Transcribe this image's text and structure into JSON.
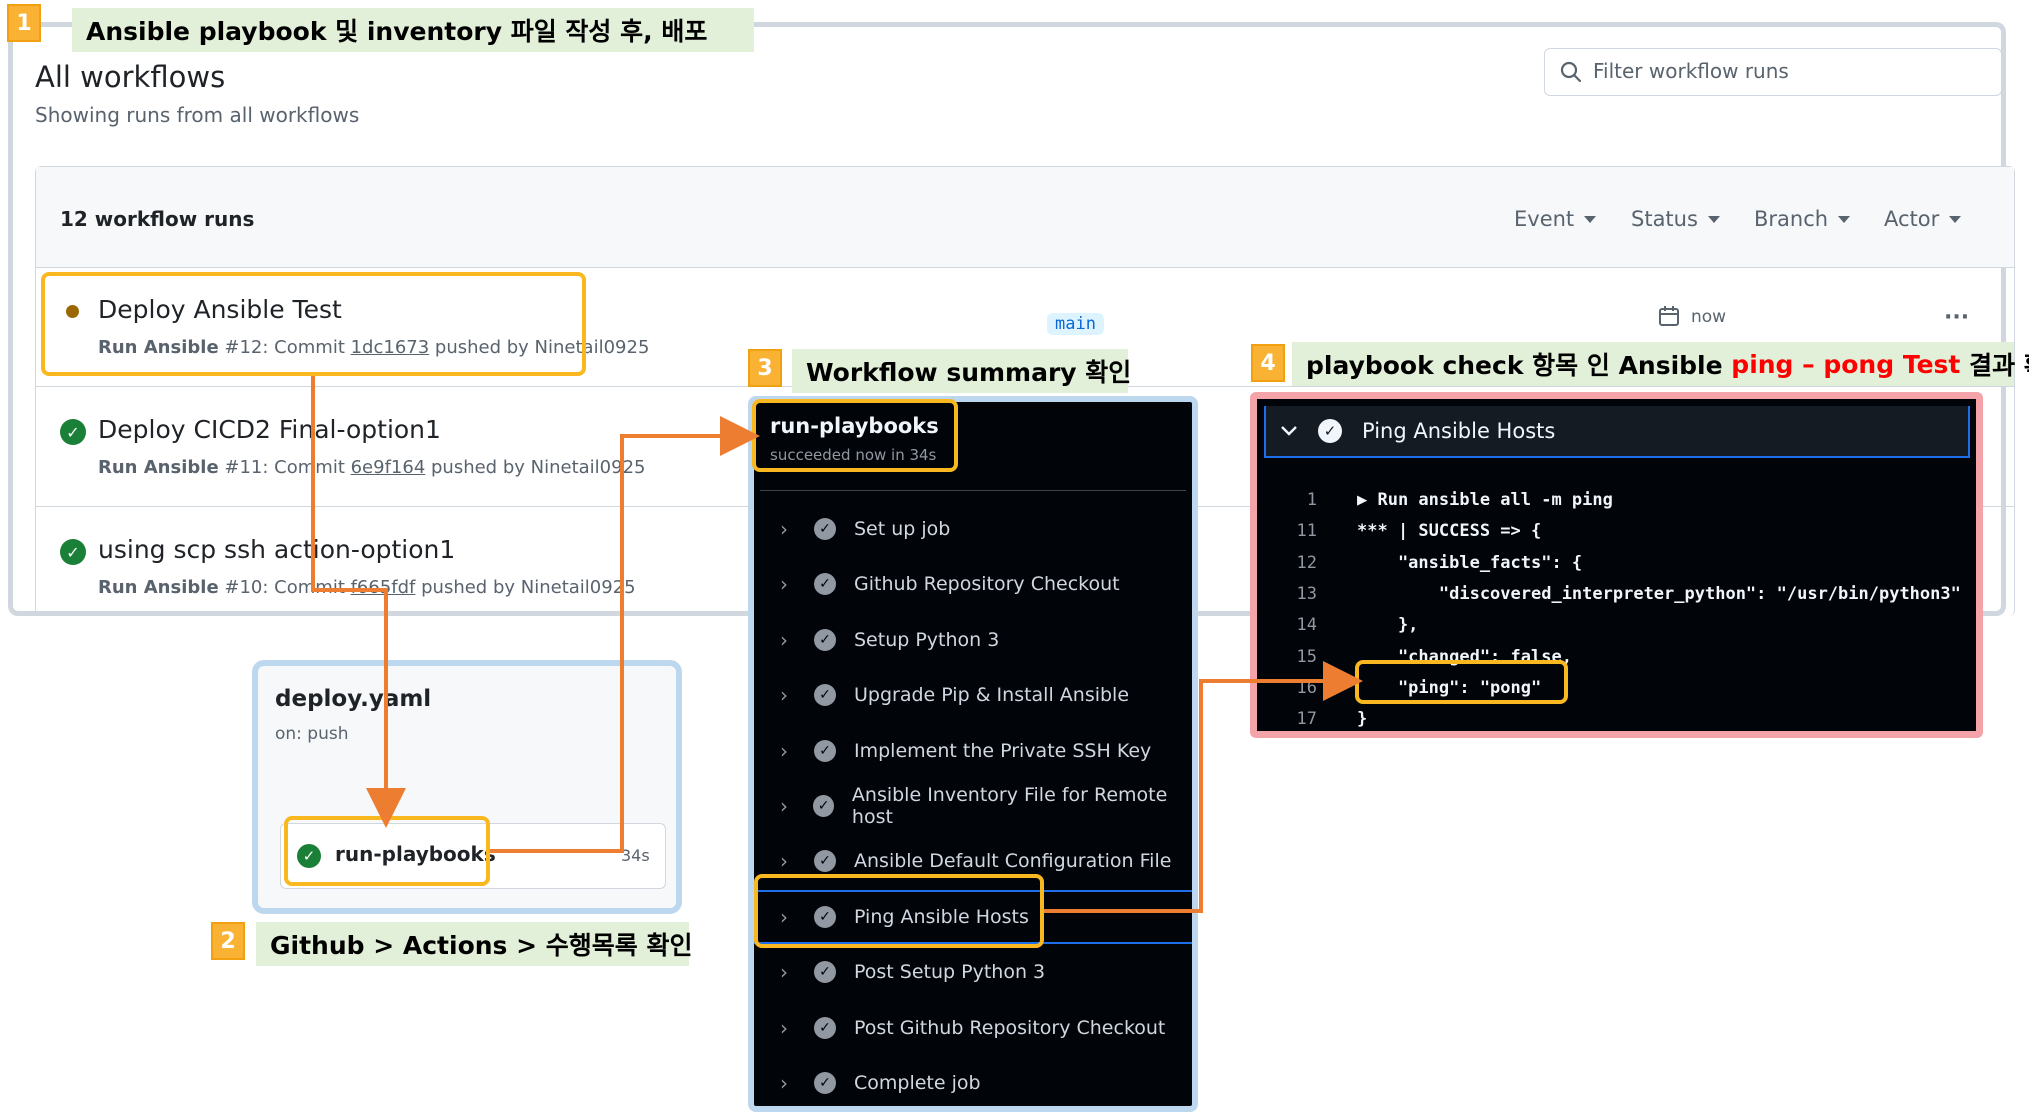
{
  "callouts": [
    {
      "num": "1",
      "text": "Ansible playbook 및 inventory 파일 작성 후, 배포"
    },
    {
      "num": "2",
      "text": "Github > Actions > 수행목록 확인"
    },
    {
      "num": "3",
      "text": "Workflow summary 확인"
    },
    {
      "num": "4",
      "text_a": "playbook check 항목 인 Ansible ",
      "text_red": "ping – pong Test",
      "text_b": " 결과 확인"
    }
  ],
  "github": {
    "page_title": "All workflows",
    "page_subtitle": "Showing runs from all workflows",
    "search_placeholder": "Filter workflow runs",
    "runs_count": "12 workflow runs",
    "filters": [
      "Event",
      "Status",
      "Branch",
      "Actor"
    ],
    "runs": [
      {
        "title": "Deploy Ansible Test",
        "workflow": "Run Ansible",
        "run": "#12: Commit ",
        "commit": "1dc1673",
        "by": " pushed by Ninetail0925",
        "status": "in-progress",
        "branch": "main",
        "time": "now"
      },
      {
        "title": "Deploy CICD2 Final-option1",
        "workflow": "Run Ansible",
        "run": "#11: Commit ",
        "commit": "6e9f164",
        "by": " pushed by Ninetail0925",
        "status": "success"
      },
      {
        "title": "using scp ssh action-option1",
        "workflow": "Run Ansible",
        "run": "#10: Commit ",
        "commit": "f665fdf",
        "by": " pushed by Ninetail0925",
        "status": "success"
      }
    ],
    "more_label": "···"
  },
  "yaml_card": {
    "file": "deploy.yaml",
    "trigger": "on: push",
    "job_name": "run-playbooks",
    "job_time": "34s"
  },
  "summary": {
    "job_name": "run-playbooks",
    "job_status": "succeeded now in 34s",
    "steps": [
      "Set up job",
      "Github Repository Checkout",
      "Setup Python 3",
      "Upgrade Pip & Install Ansible",
      "Implement the Private SSH Key",
      "Ansible Inventory File for Remote host",
      "Ansible Default Configuration File",
      "Ping Ansible Hosts",
      "Post Setup Python 3",
      "Post Github Repository Checkout",
      "Complete job"
    ]
  },
  "log": {
    "step_title": "Ping Ansible Hosts",
    "lines": [
      {
        "n": "1",
        "text": "▶ Run ansible all -m ping"
      },
      {
        "n": "11",
        "text": "*** | SUCCESS => {"
      },
      {
        "n": "12",
        "text": "    \"ansible_facts\": {"
      },
      {
        "n": "13",
        "text": "        \"discovered_interpreter_python\": \"/usr/bin/python3\""
      },
      {
        "n": "14",
        "text": "    },"
      },
      {
        "n": "15",
        "text": "    \"changed\": false,"
      },
      {
        "n": "16",
        "text": "    \"ping\": \"pong\""
      },
      {
        "n": "17",
        "text": "}"
      }
    ]
  },
  "colors": {
    "callout_bg": "#e2efd9",
    "badge": "#f9b233",
    "highlight": "#f9b820",
    "arrow": "#ed7d31",
    "success": "#1a7f37",
    "in_progress": "#9a6700"
  }
}
